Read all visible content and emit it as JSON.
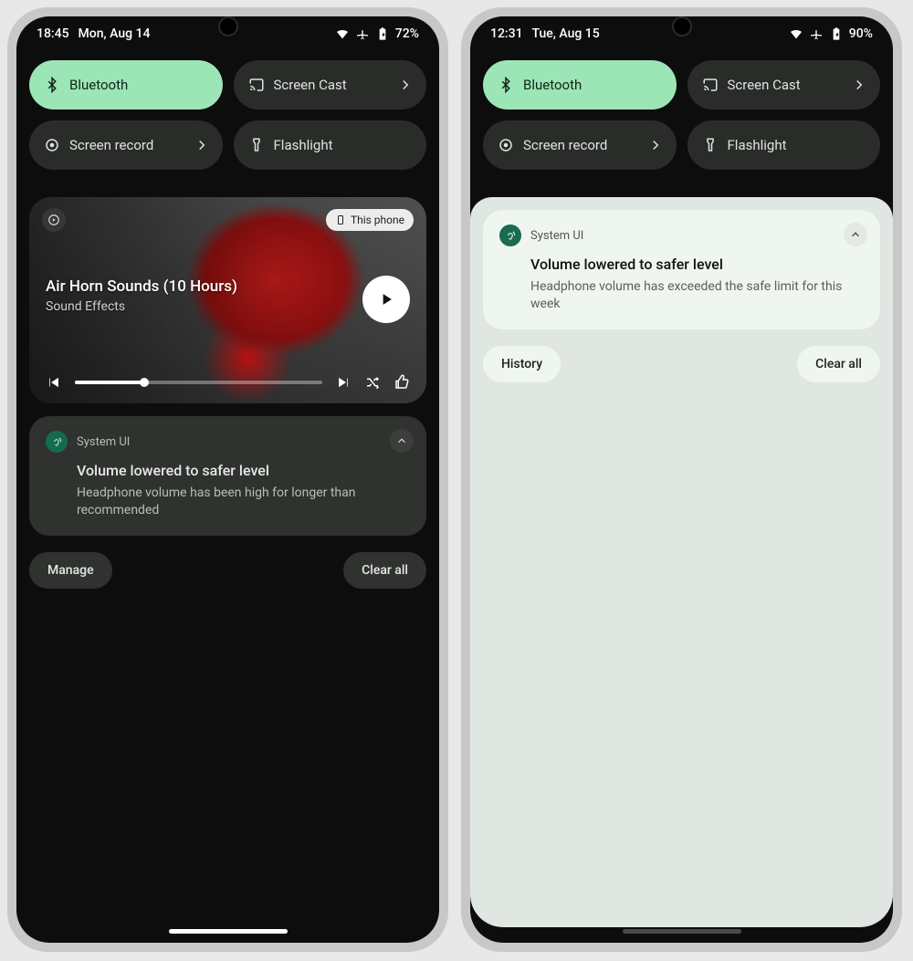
{
  "phones": [
    {
      "theme": "dark",
      "status": {
        "time": "18:45",
        "date": "Mon, Aug 14",
        "battery": "72%"
      },
      "qs": {
        "bluetooth": "Bluetooth",
        "cast": "Screen Cast",
        "record": "Screen record",
        "flashlight": "Flashlight"
      },
      "media": {
        "device_chip": "This phone",
        "title": "Air Horn Sounds (10 Hours)",
        "subtitle": "Sound Effects"
      },
      "notif": {
        "app": "System UI",
        "title": "Volume lowered to safer level",
        "body": "Headphone volume has been high for longer than recommended"
      },
      "actions": {
        "left": "Manage",
        "right": "Clear all"
      }
    },
    {
      "theme": "light",
      "status": {
        "time": "12:31",
        "date": "Tue, Aug 15",
        "battery": "90%"
      },
      "qs": {
        "bluetooth": "Bluetooth",
        "cast": "Screen Cast",
        "record": "Screen record",
        "flashlight": "Flashlight"
      },
      "notif": {
        "app": "System UI",
        "title": "Volume lowered to safer level",
        "body": "Headphone volume has exceeded the safe limit for this week"
      },
      "actions": {
        "left": "History",
        "right": "Clear all"
      }
    }
  ]
}
